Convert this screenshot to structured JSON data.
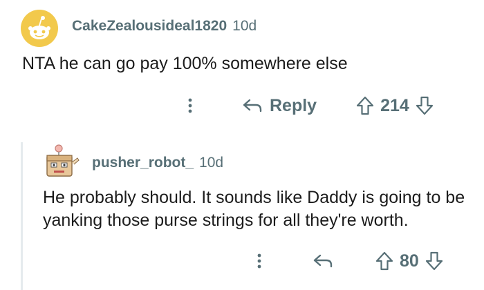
{
  "comment": {
    "username": "CakeZealousideal1820",
    "age": "10d",
    "body": "NTA he can go pay 100% somewhere else",
    "reply_label": "Reply",
    "score": "214",
    "avatar_icon": "reddit-snoo-avatar",
    "avatar_color": "#f2c94c"
  },
  "reply": {
    "username": "pusher_robot_",
    "age": "10d",
    "body": "He probably should. It sounds like Daddy is going to be yanking those purse strings for all they're worth.",
    "score": "80",
    "avatar_icon": "robot-avatar"
  },
  "colors": {
    "meta": "#576f76",
    "text": "#1c1c1c",
    "thread_line": "#e5ebee"
  }
}
